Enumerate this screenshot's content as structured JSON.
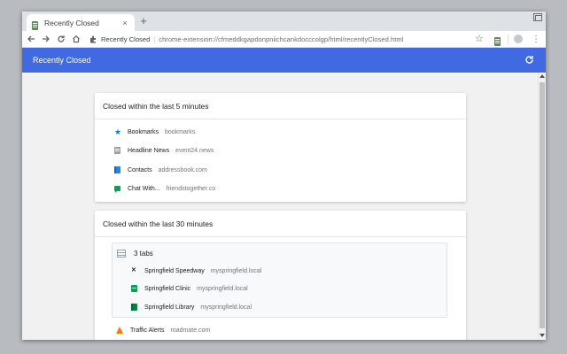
{
  "browser": {
    "tab_title": "Recently Closed",
    "tab_close": "×",
    "new_tab": "+",
    "omnibox_extension_name": "Recently Closed",
    "omnibox_separator": "|",
    "omnibox_url": "chrome-extension://cfmeddkgapdonpniichcankdocccolgp/html/recentlyClosed.html",
    "nav_icons": [
      "back-arrow-icon",
      "forward-arrow-icon",
      "reload-icon",
      "home-icon"
    ]
  },
  "app": {
    "header_title": "Recently Closed",
    "accent_color": "#4169e1"
  },
  "sections": [
    {
      "heading": "Closed within the last 5 minutes",
      "items": [
        {
          "title": "Bookmarks",
          "url": "bookmarks",
          "icon": "star-icon"
        },
        {
          "title": "Headline News",
          "url": "event24.news",
          "icon": "news-icon"
        },
        {
          "title": "Contacts",
          "url": "addressbook.com",
          "icon": "contacts-icon"
        },
        {
          "title": "Chat With...",
          "url": "friendstogether.co",
          "icon": "chat-icon"
        }
      ]
    },
    {
      "heading": "Closed within the last 30 minutes",
      "group": {
        "label": "3 tabs",
        "items": [
          {
            "title": "Springfield Speedway",
            "url": "myspringfield.local",
            "icon": "speedway-icon"
          },
          {
            "title": "Springfield Clinic",
            "url": "myspringfield.local",
            "icon": "clinic-icon"
          },
          {
            "title": "Springfield Library",
            "url": "myspringfield.local",
            "icon": "library-icon"
          }
        ]
      },
      "items": [
        {
          "title": "Traffic Alerts",
          "url": "roadmate.com",
          "icon": "traffic-cone-icon"
        }
      ]
    }
  ]
}
